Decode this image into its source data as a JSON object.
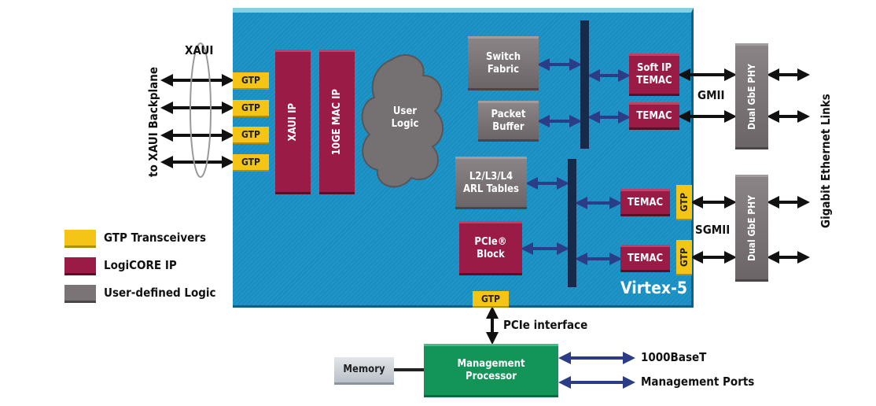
{
  "colors": {
    "gtp": "#f4c417",
    "logicore": "#9a1b45",
    "user_logic": "#7a7476",
    "fpga": "#1f95c8",
    "processor": "#13955a",
    "bus": "#162a4c"
  },
  "left": {
    "xaui": "XAUI",
    "backplane": "to XAUI Backplane",
    "gtp": [
      "GTP",
      "GTP",
      "GTP",
      "GTP"
    ]
  },
  "fpga": {
    "label": "Virtex-5",
    "xaui_ip": "XAUI IP",
    "mac_ip": "10GE MAC IP",
    "user_logic": "User\nLogic",
    "switch_fabric": "Switch\nFabric",
    "packet_buffer": "Packet\nBuffer",
    "arl_tables": "L2/L3/L4\nARL Tables",
    "pcie_block": "PCIe®\nBlock",
    "soft_temac": "Soft IP\nTEMAC",
    "temac": [
      "TEMAC",
      "TEMAC",
      "TEMAC"
    ],
    "gtp_right": [
      "GTP",
      "GTP"
    ],
    "gtp_bottom": "GTP"
  },
  "right": {
    "gmii": "GMII",
    "sgmii": "SGMII",
    "phy": [
      "Dual GbE PHY",
      "Dual GbE PHY"
    ],
    "links": "Gigabit Ethernet Links"
  },
  "legend": [
    {
      "label": "GTP Transceivers"
    },
    {
      "label": "LogiCORE IP"
    },
    {
      "label": "User-defined Logic"
    }
  ],
  "bottom": {
    "pcie_interface": "PCIe interface",
    "processor": "Management\nProcessor",
    "memory": "Memory",
    "port1": "1000BaseT",
    "port2": "Management Ports"
  }
}
